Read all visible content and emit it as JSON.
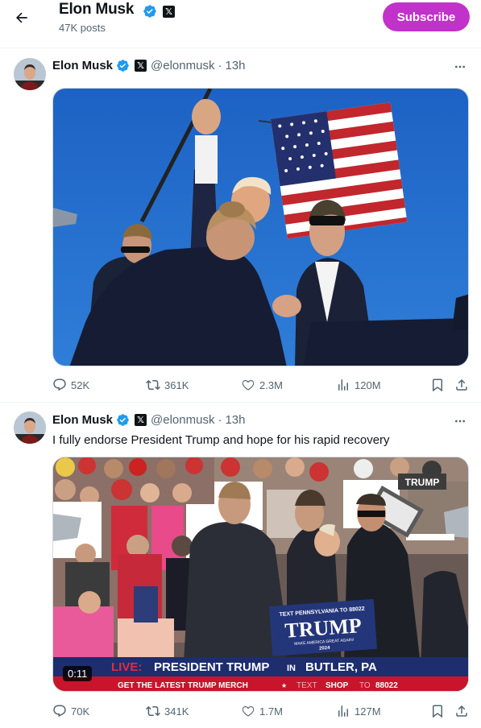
{
  "header": {
    "name": "Elon Musk",
    "posts": "47K posts",
    "subscribe_label": "Subscribe",
    "back_icon": "arrow-left-icon"
  },
  "colors": {
    "verified": "#1d9bf0",
    "subscribe": "#c032c9",
    "secondary_text": "#536471"
  },
  "tweets": [
    {
      "name": "Elon Musk",
      "handle": "@elonmusk",
      "time": "13h",
      "text": "",
      "media": "photo",
      "stats": {
        "replies": "52K",
        "reposts": "361K",
        "likes": "2.3M",
        "views": "120M"
      }
    },
    {
      "name": "Elon Musk",
      "handle": "@elonmusk",
      "time": "13h",
      "text": "I fully endorse President Trump and hope for his rapid recovery",
      "media": "video",
      "video_duration": "0:11",
      "overlay": {
        "live": "LIVE:",
        "headline_pre": "PRESIDENT TRUMP",
        "headline_in": "IN",
        "headline_post": "BUTLER, PA",
        "ticker_a": "GET THE LATEST TRUMP MERCH",
        "ticker_star": "★",
        "ticker_text": "TEXT",
        "ticker_shop": "SHOP",
        "ticker_to": "TO",
        "ticker_num": "88022",
        "sign_top": "TEXT PENNSYLVANIA TO 88022",
        "sign_main": "TRUMP",
        "sign_sub": "MAKE AMERICA GREAT AGAIN!",
        "sign_year": "2024",
        "bg_sign": "TRUMP"
      },
      "stats": {
        "replies": "70K",
        "reposts": "341K",
        "likes": "1.7M",
        "views": "127M"
      }
    }
  ]
}
